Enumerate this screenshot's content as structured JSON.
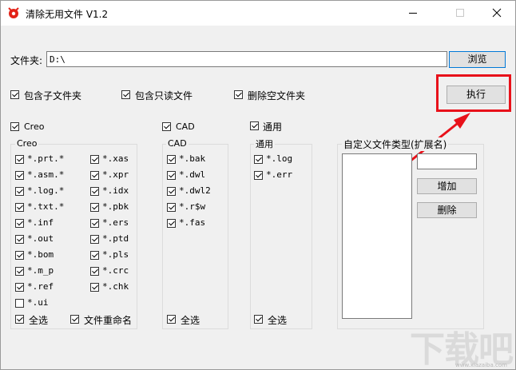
{
  "window": {
    "title": "清除无用文件  V1.2"
  },
  "folder": {
    "label": "文件夹:",
    "value": "D:\\",
    "browse": "浏览"
  },
  "options": [
    "包含子文件夹",
    "包含只读文件",
    "删除空文件夹"
  ],
  "execute": "执行",
  "creo": {
    "header": "Creo",
    "group_title": "Creo",
    "col1": [
      "*.prt.*",
      "*.asm.*",
      "*.log.*",
      "*.txt.*",
      "*.inf",
      "*.out",
      "*.bom",
      "*.m_p",
      "*.ref",
      "*.ui"
    ],
    "col1_checked": [
      true,
      true,
      true,
      true,
      true,
      true,
      true,
      true,
      true,
      false
    ],
    "col2": [
      "*.xas",
      "*.xpr",
      "*.idx",
      "*.pbk",
      "*.ers",
      "*.ptd",
      "*.pls",
      "*.crc",
      "*.chk"
    ],
    "select_all": "全选",
    "rename": "文件重命名"
  },
  "cad": {
    "header": "CAD",
    "group_title": "CAD",
    "items": [
      "*.bak",
      "*.dwl",
      "*.dwl2",
      "*.r$w",
      "*.fas"
    ],
    "select_all": "全选"
  },
  "general": {
    "header": "通用",
    "group_title": "通用",
    "items": [
      "*.log",
      "*.err"
    ],
    "select_all": "全选"
  },
  "custom": {
    "title": "自定义文件类型(扩展名)",
    "input_value": "",
    "add": "增加",
    "remove": "删除"
  },
  "watermark": {
    "text": "下载吧",
    "url": "www.xiazaiba.com"
  },
  "colors": {
    "highlight": "#e8111a",
    "focus_border": "#0078d7"
  }
}
